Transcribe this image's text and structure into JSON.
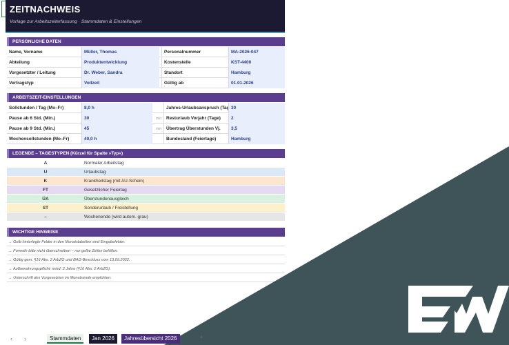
{
  "header": {
    "title": "ZEITNACHWEIS",
    "subtitle": "Vorlage zur Arbeitszeiterfassung · Stammdaten & Einstellungen"
  },
  "personal": {
    "section_title": "PERSÖNLICHE DATEN",
    "rows": [
      {
        "label1": "Name, Vorname",
        "value1": "Müller, Thomas",
        "label2": "Personalnummer",
        "value2": "MA-2026-047"
      },
      {
        "label1": "Abteilung",
        "value1": "Produktentwicklung",
        "label2": "Kostenstelle",
        "value2": "KST-4400"
      },
      {
        "label1": "Vorgesetzter / Leitung",
        "value1": "Dr. Weber, Sandra",
        "label2": "Standort",
        "value2": "Hamburg"
      },
      {
        "label1": "Vertragstyp",
        "value1": "Vollzeit",
        "label2": "Gültig ab",
        "value2": "01.01.2026"
      }
    ]
  },
  "worktime": {
    "section_title": "ARBEITSZEIT-EINSTELLUNGEN",
    "rows": [
      {
        "label1": "Sollstunden / Tag (Mo–Fr)",
        "value1": "8,0 h",
        "unit": "",
        "label2": "Jahres-Urlaubsanspruch (Tage)",
        "value2": "30"
      },
      {
        "label1": "Pause ab 6 Std. (Min.)",
        "value1": "30",
        "unit": "min",
        "label2": "Resturlaub Vorjahr (Tage)",
        "value2": "2"
      },
      {
        "label1": "Pause ab 9 Std. (Min.)",
        "value1": "45",
        "unit": "min",
        "label2": "Übertrag Überstunden Vj.",
        "value2": "3,5"
      },
      {
        "label1": "Wochensollstunden (Mo–Fr)",
        "value1": "40,0 h",
        "unit": "",
        "label2": "Bundesland (Feiertage)",
        "value2": "Hamburg"
      }
    ]
  },
  "legend": {
    "section_title": "LEGENDE – TAGESTYPEN (Kürzel für Spalte »Typ«)",
    "items": [
      {
        "code": "A",
        "desc": "Normaler Arbeitstag",
        "color": "#ffffff"
      },
      {
        "code": "U",
        "desc": "Urlaubstag",
        "color": "#dbe8f6"
      },
      {
        "code": "K",
        "desc": "Krankheitstag (mit AU-Schein)",
        "color": "#fde6cf"
      },
      {
        "code": "FT",
        "desc": "Gesetzlicher Feiertag",
        "color": "#e6d9f2"
      },
      {
        "code": "ÜA",
        "desc": "Überstundenausgleich",
        "color": "#d9f1e1"
      },
      {
        "code": "ST",
        "desc": "Sonderurlaub / Freistellung",
        "color": "#fdf1cc"
      },
      {
        "code": "–",
        "desc": "Wochenende (wird autom. grau)",
        "color": "#e6e6e6"
      }
    ]
  },
  "hints": {
    "section_title": "WICHTIGE HINWEISE",
    "items": [
      "→ Gelb hinterlegte Felder in den Monatstabellen sind Eingabefelder.",
      "→ Formeln bitte nicht überschreiben – nur gelbe Zellen befüllen.",
      "→ Gültig gem. §16 Abs. 2 ArbZG und BAG-Beschluss vom 13.09.2022.",
      "→ Aufbewahrungspflicht: mind. 2 Jahre (§16 Abs. 2 ArbZG).",
      "→ Unterschrift des Vorgesetzten im Monatsende empfohlen."
    ]
  },
  "tabs": {
    "prev_icon": "‹",
    "next_icon": "›",
    "add_icon": "+",
    "items": [
      {
        "label": "Stammdaten",
        "active": true
      },
      {
        "label": "Jan 2026",
        "active": false
      },
      {
        "label": "Jahresübersicht 2026",
        "active": false
      }
    ]
  },
  "colors": {
    "header_bg": "#1c1a33",
    "section_bg": "#5a3d8e",
    "input_bg": "#e8eefb",
    "corner_bg": "#3f5459"
  }
}
